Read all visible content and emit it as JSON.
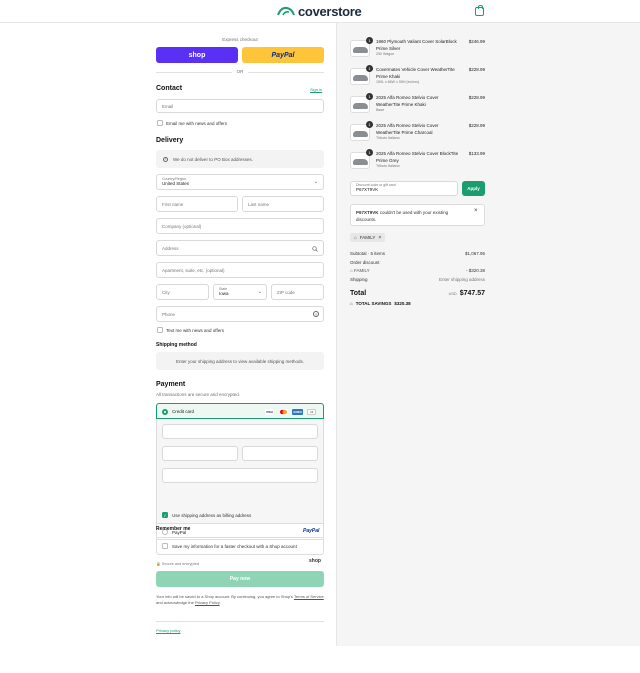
{
  "header": {
    "brand": "coverstore",
    "cart_icon": "bag-icon"
  },
  "express": {
    "label": "Express checkout",
    "shop_label": "shop",
    "paypal_label": "PayPal",
    "or_label": "OR"
  },
  "contact": {
    "title": "Contact",
    "sign_in": "Sign in",
    "email_placeholder": "Email",
    "news_label": "Email me with news and offers"
  },
  "delivery": {
    "title": "Delivery",
    "po_notice": "We do not deliver to PO Box addresses.",
    "country_label": "Country/Region",
    "country_value": "United States",
    "first_name": "First name",
    "last_name": "Last name",
    "company": "Company (optional)",
    "address": "Address",
    "apartment": "Apartment, suite, etc. (optional)",
    "city": "City",
    "state_label": "State",
    "state_value": "Iowa",
    "zip": "ZIP code",
    "phone": "Phone",
    "text_news": "Text me with news and offers"
  },
  "shipping_method": {
    "title": "Shipping method",
    "notice": "Enter your shipping address to view available shipping methods."
  },
  "payment": {
    "title": "Payment",
    "subtitle": "All transactions are secure and encrypted.",
    "credit_card_label": "Credit card",
    "card_brands": [
      "VISA",
      "MC",
      "AMEX",
      "+5"
    ],
    "billing_label": "Use shipping address as billing address",
    "paypal_label": "PayPal",
    "paypal_logo": "PayPal"
  },
  "remember": {
    "title": "Remember me",
    "save_label": "Save my information for a faster checkout with a Shop account",
    "secure_label": "Secure and encrypted",
    "shop_logo": "shop"
  },
  "pay": {
    "button": "Pay now",
    "legal_1": "Your info will be saved to a Shop account. By continuing, you agree to Shop's",
    "terms": "Terms of Service",
    "legal_2": "and acknowledge the",
    "privacy": "Privacy Policy",
    "privacy_link": "Privacy policy"
  },
  "order": {
    "items": [
      {
        "qty": "1",
        "name": "1960 Plymouth Valiant Cover SolarBlock Prime Silver",
        "variant": "250 Wagon",
        "price": "$246.99"
      },
      {
        "qty": "1",
        "name": "Covermates Vehicle Cover WeatherTite Prime Khaki",
        "variant": "159L x 66W x 55H (inches)",
        "price": "$228.99"
      },
      {
        "qty": "1",
        "name": "2025 Alfa Romeo Stelvio Cover WeatherTite Prime Khaki",
        "variant": "Base",
        "price": "$228.99"
      },
      {
        "qty": "1",
        "name": "2025 Alfa Romeo Stelvio Cover WeatherTite Prime Charcoal",
        "variant": "Tributo Italiano",
        "price": "$228.99"
      },
      {
        "qty": "1",
        "name": "2025 Alfa Romeo Stelvio Cover BlockTite Prime Grey",
        "variant": "Tributo Italiano",
        "price": "$133.99"
      }
    ],
    "discount_label": "Discount code or gift card",
    "discount_value": "P67XT9VK",
    "apply": "Apply",
    "error_code": "P67XT9VK",
    "error_text": "couldn't be used with your existing discounts.",
    "tag": "FAMILY",
    "subtotal_label": "Subtotal · 5 items",
    "subtotal_value": "$1,067.95",
    "order_discount_label": "Order discount",
    "discount_code": "FAMILY",
    "discount_amount": "- $320.38",
    "shipping_label": "Shipping",
    "shipping_value": "Enter shipping address",
    "total_label": "Total",
    "currency": "USD",
    "total_value": "$747.57",
    "savings_label": "TOTAL SAVINGS",
    "savings_value": "$320.38"
  }
}
